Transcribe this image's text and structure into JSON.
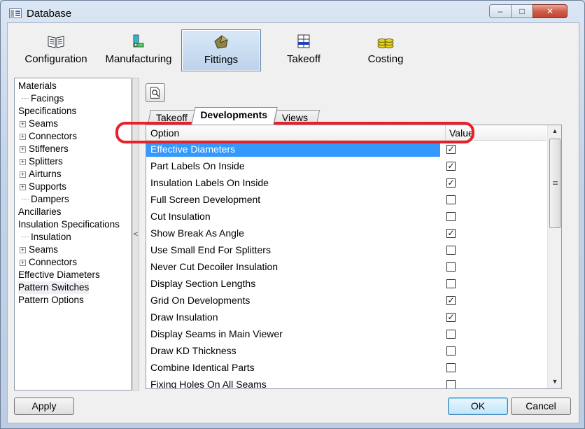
{
  "window": {
    "title": "Database"
  },
  "titlebar": {
    "minimize": "–",
    "maximize": "□",
    "close": "✕"
  },
  "toolbar": [
    {
      "label": "Configuration",
      "icon": "book-icon",
      "active": false
    },
    {
      "label": "Manufacturing",
      "icon": "manufacturing-icon",
      "active": false
    },
    {
      "label": "Fittings",
      "icon": "fittings-icon",
      "active": true
    },
    {
      "label": "Takeoff",
      "icon": "takeoff-icon",
      "active": false
    },
    {
      "label": "Costing",
      "icon": "coins-icon",
      "active": false
    }
  ],
  "tree": [
    {
      "label": "Materials",
      "level": 0,
      "expander": "none"
    },
    {
      "label": "Facings",
      "level": 1,
      "expander": "leaf"
    },
    {
      "label": "Specifications",
      "level": 0,
      "expander": "none"
    },
    {
      "label": "Seams",
      "level": 1,
      "expander": "plus"
    },
    {
      "label": "Connectors",
      "level": 1,
      "expander": "plus"
    },
    {
      "label": "Stiffeners",
      "level": 1,
      "expander": "plus"
    },
    {
      "label": "Splitters",
      "level": 1,
      "expander": "plus"
    },
    {
      "label": "Airturns",
      "level": 1,
      "expander": "plus"
    },
    {
      "label": "Supports",
      "level": 1,
      "expander": "plus"
    },
    {
      "label": "Dampers",
      "level": 1,
      "expander": "leaf"
    },
    {
      "label": "Ancillaries",
      "level": 0,
      "expander": "none"
    },
    {
      "label": "Insulation Specifications",
      "level": 0,
      "expander": "none"
    },
    {
      "label": "Insulation",
      "level": 1,
      "expander": "leaf"
    },
    {
      "label": "Seams",
      "level": 1,
      "expander": "plus"
    },
    {
      "label": "Connectors",
      "level": 1,
      "expander": "plus"
    },
    {
      "label": "Effective Diameters",
      "level": 0,
      "expander": "none"
    },
    {
      "label": "Pattern Switches",
      "level": 0,
      "expander": "none",
      "selected": true
    },
    {
      "label": "Pattern Options",
      "level": 0,
      "expander": "none"
    }
  ],
  "splitter": {
    "arrow": "<"
  },
  "tabs": [
    {
      "label": "Takeoff",
      "active": false
    },
    {
      "label": "Developments",
      "active": true
    },
    {
      "label": "Views",
      "active": false
    }
  ],
  "grid": {
    "columns": [
      "Option",
      "Value"
    ],
    "rows": [
      {
        "option": "Effective Diameters",
        "checked": true,
        "selected": true
      },
      {
        "option": "Part Labels On Inside",
        "checked": true
      },
      {
        "option": "Insulation Labels On Inside",
        "checked": true
      },
      {
        "option": "Full Screen Development",
        "checked": false
      },
      {
        "option": "Cut Insulation",
        "checked": false
      },
      {
        "option": "Show Break As Angle",
        "checked": true
      },
      {
        "option": "Use Small End For Splitters",
        "checked": false
      },
      {
        "option": "Never Cut Decoiler Insulation",
        "checked": false
      },
      {
        "option": "Display Section Lengths",
        "checked": false
      },
      {
        "option": "Grid On Developments",
        "checked": true
      },
      {
        "option": "Draw Insulation",
        "checked": true
      },
      {
        "option": "Display Seams in Main Viewer",
        "checked": false
      },
      {
        "option": "Draw KD Thickness",
        "checked": false
      },
      {
        "option": "Combine Identical Parts",
        "checked": false
      },
      {
        "option": "Fixing Holes On All Seams",
        "checked": false
      }
    ]
  },
  "buttons": {
    "apply": "Apply",
    "ok": "OK",
    "cancel": "Cancel"
  },
  "colors": {
    "selection": "#3399ff",
    "annotation": "#e8202a",
    "active_tab_bg": "#ffffff"
  }
}
